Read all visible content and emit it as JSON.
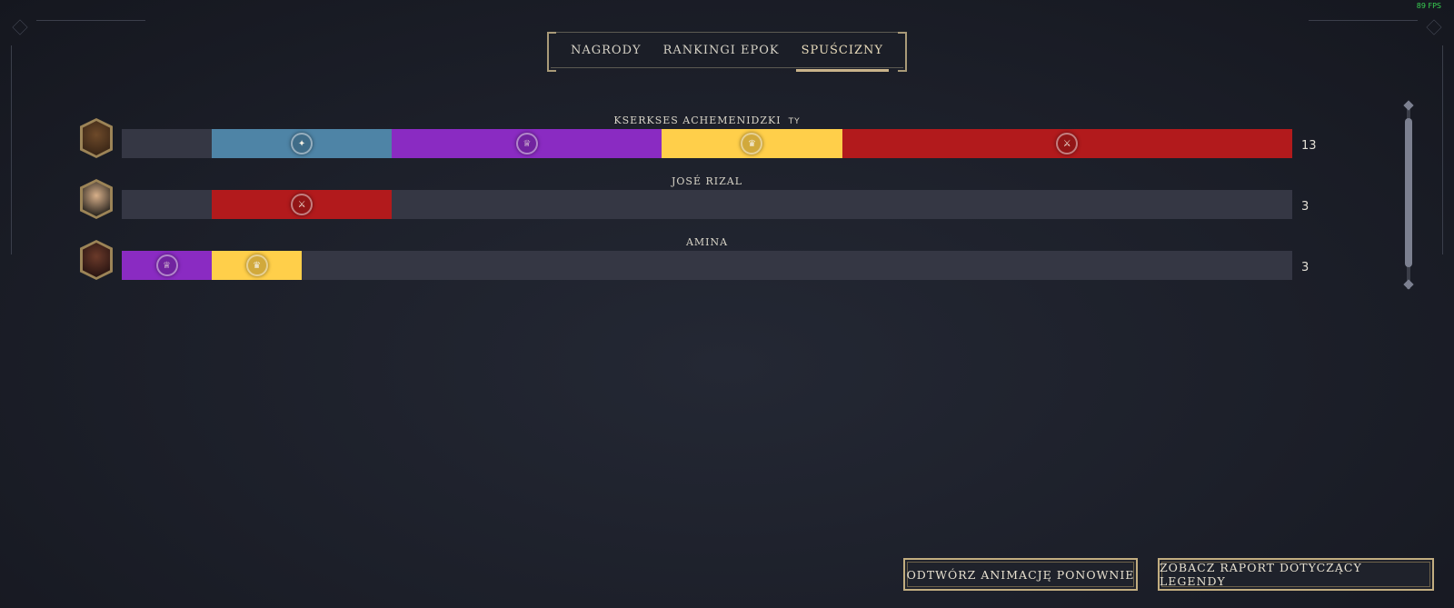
{
  "fps": "89 FPS",
  "tabs": [
    {
      "label": "NAGRODY",
      "active": false
    },
    {
      "label": "RANKINGI EPOK",
      "active": false
    },
    {
      "label": "SPUŚCIZNY",
      "active": true
    }
  ],
  "legacy_rows": [
    {
      "name": "KSERKSES ACHEMENIDZKI",
      "you_tag": "TY",
      "score": "13",
      "avatar_icon": "leader-portrait-icon",
      "segments": [
        {
          "type": "empty",
          "color": "#353744",
          "units": 1,
          "icon": ""
        },
        {
          "type": "science",
          "color": "#4e84a6",
          "units": 2,
          "icon": "science-legacy-icon"
        },
        {
          "type": "culture",
          "color": "#8a2bc2",
          "units": 3,
          "icon": "culture-legacy-icon"
        },
        {
          "type": "economic",
          "color": "#ffcf4a",
          "units": 2,
          "icon": "economic-legacy-icon"
        },
        {
          "type": "military",
          "color": "#b21a1c",
          "units": 5,
          "icon": "military-legacy-icon"
        }
      ]
    },
    {
      "name": "JOSÉ RIZAL",
      "you_tag": "",
      "score": "3",
      "avatar_icon": "leader-portrait-icon",
      "segments": [
        {
          "type": "empty",
          "color": "#353744",
          "units": 1,
          "icon": ""
        },
        {
          "type": "military",
          "color": "#b21a1c",
          "units": 2,
          "icon": "military-legacy-icon"
        }
      ]
    },
    {
      "name": "AMINA",
      "you_tag": "",
      "score": "3",
      "avatar_icon": "leader-portrait-icon",
      "segments": [
        {
          "type": "culture",
          "color": "#8a2bc2",
          "units": 1,
          "icon": "culture-legacy-icon"
        },
        {
          "type": "economic",
          "color": "#ffcf4a",
          "units": 1,
          "icon": "economic-legacy-icon"
        }
      ]
    }
  ],
  "buttons": {
    "replay": "ODTWÓRZ ANIMACJĘ PONOWNIE",
    "report": "ZOBACZ RAPORT DOTYCZĄCY LEGENDY"
  }
}
